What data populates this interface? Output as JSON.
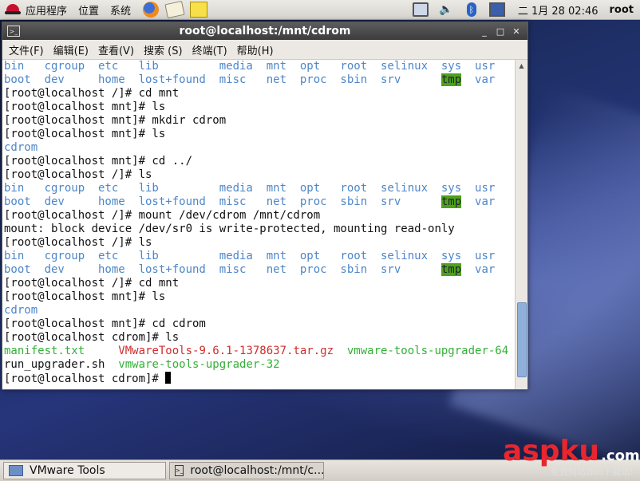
{
  "top_panel": {
    "menu": [
      "应用程序",
      "位置",
      "系统"
    ],
    "clock": "二 1月 28 02:46",
    "user": "root"
  },
  "terminal": {
    "title": "root@localhost:/mnt/cdrom",
    "menu": [
      "文件(F)",
      "编辑(E)",
      "查看(V)",
      "搜索 (S)",
      "终端(T)",
      "帮助(H)"
    ],
    "lines": [
      [
        {
          "t": "bin   cgroup  etc   lib         media  mnt  opt   root  selinux  sys  usr",
          "c": "blue"
        }
      ],
      [
        {
          "t": "boot  dev     home  lost+found  misc   net  proc  sbin  srv      ",
          "c": "blue"
        },
        {
          "t": "tmp",
          "c": "hl"
        },
        {
          "t": "  var",
          "c": "blue"
        }
      ],
      [
        {
          "t": "[root@localhost /]# cd mnt",
          "c": "prompt"
        }
      ],
      [
        {
          "t": "[root@localhost mnt]# ls",
          "c": "prompt"
        }
      ],
      [
        {
          "t": "[root@localhost mnt]# mkdir cdrom",
          "c": "prompt"
        }
      ],
      [
        {
          "t": "[root@localhost mnt]# ls",
          "c": "prompt"
        }
      ],
      [
        {
          "t": "cdrom",
          "c": "blue"
        }
      ],
      [
        {
          "t": "[root@localhost mnt]# cd ../",
          "c": "prompt"
        }
      ],
      [
        {
          "t": "[root@localhost /]# ls",
          "c": "prompt"
        }
      ],
      [
        {
          "t": "bin   cgroup  etc   lib         media  mnt  opt   root  selinux  sys  usr",
          "c": "blue"
        }
      ],
      [
        {
          "t": "boot  dev     home  lost+found  misc   net  proc  sbin  srv      ",
          "c": "blue"
        },
        {
          "t": "tmp",
          "c": "hl"
        },
        {
          "t": "  var",
          "c": "blue"
        }
      ],
      [
        {
          "t": "[root@localhost /]# mount /dev/cdrom /mnt/cdrom",
          "c": "prompt"
        }
      ],
      [
        {
          "t": "mount: block device /dev/sr0 is write-protected, mounting read-only",
          "c": "prompt"
        }
      ],
      [
        {
          "t": "[root@localhost /]# ls",
          "c": "prompt"
        }
      ],
      [
        {
          "t": "bin   cgroup  etc   lib         media  mnt  opt   root  selinux  sys  usr",
          "c": "blue"
        }
      ],
      [
        {
          "t": "boot  dev     home  lost+found  misc   net  proc  sbin  srv      ",
          "c": "blue"
        },
        {
          "t": "tmp",
          "c": "hl"
        },
        {
          "t": "  var",
          "c": "blue"
        }
      ],
      [
        {
          "t": "[root@localhost /]# cd mnt",
          "c": "prompt"
        }
      ],
      [
        {
          "t": "[root@localhost mnt]# ls",
          "c": "prompt"
        }
      ],
      [
        {
          "t": "cdrom",
          "c": "blue"
        }
      ],
      [
        {
          "t": "[root@localhost mnt]# cd cdrom",
          "c": "prompt"
        }
      ],
      [
        {
          "t": "[root@localhost cdrom]# ls",
          "c": "prompt"
        }
      ],
      [
        {
          "t": "manifest.txt     ",
          "c": "green"
        },
        {
          "t": "VMwareTools-9.6.1-1378637.tar.gz",
          "c": "red"
        },
        {
          "t": "  vmware-tools-upgrader-64",
          "c": "green"
        }
      ],
      [
        {
          "t": "run_upgrader.sh  ",
          "c": "prompt"
        },
        {
          "t": "vmware-tools-upgrader-32",
          "c": "green"
        }
      ],
      [
        {
          "t": "[root@localhost cdrom]# ",
          "c": "prompt"
        }
      ]
    ]
  },
  "taskbar": {
    "items": [
      "VMware Tools",
      "root@localhost:/mnt/c..."
    ]
  },
  "watermark": {
    "brand": "aspku",
    "suffix": ".com",
    "sub": "免费网站源码下载站!"
  },
  "colors": {
    "blue": "#4d86c8",
    "green": "#33b036",
    "red": "#d12b2b",
    "highlight": "#4ea21a"
  }
}
